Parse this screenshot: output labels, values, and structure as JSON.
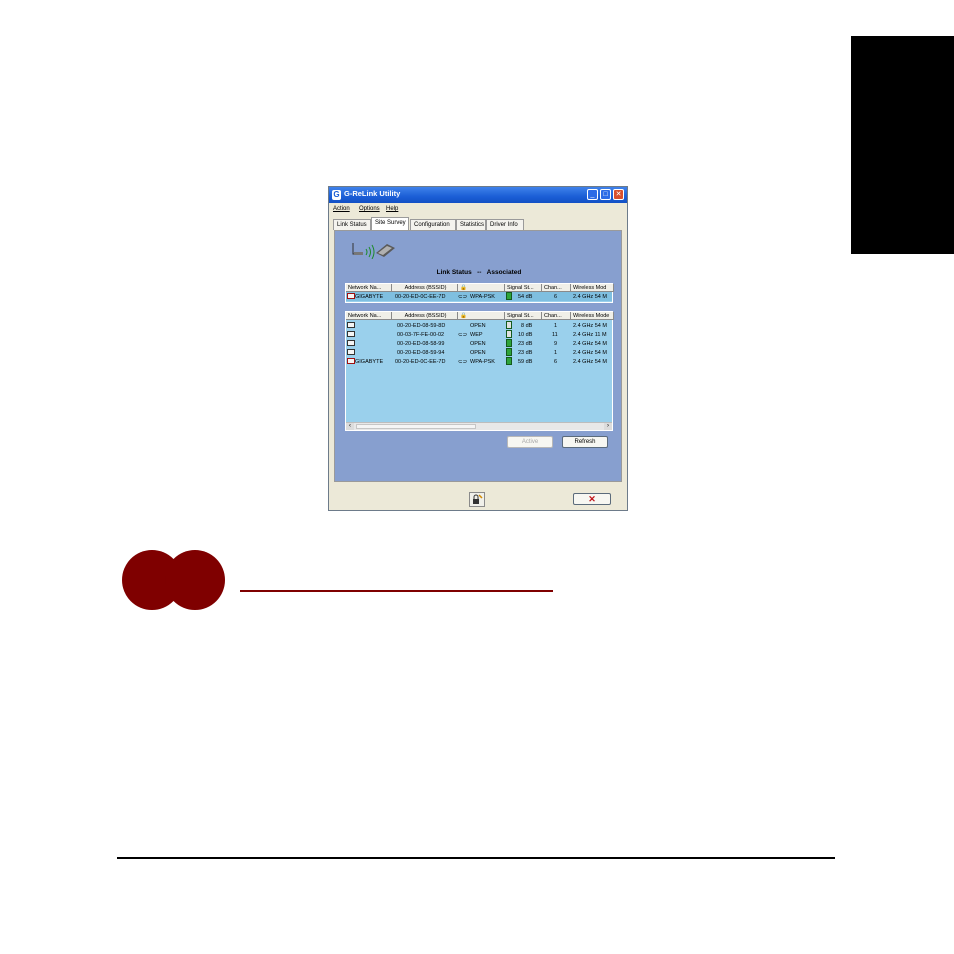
{
  "window": {
    "title": "G-ReLink Utility",
    "app_icon_glyph": "G",
    "menu": [
      "Action",
      "Options",
      "Help"
    ],
    "tabs": [
      "Link Status",
      "Site Survey",
      "Configuration",
      "Statistics",
      "Driver Info"
    ],
    "active_tab": "Site Survey"
  },
  "link_status": {
    "label": "Link Status",
    "separator": "--",
    "value": "Associated"
  },
  "columns": {
    "top": [
      "Network Na...",
      "Address (BSSID)",
      "",
      "Signal St...",
      "Chan...",
      "Wireless Mod"
    ],
    "bottom": [
      "Network Na...",
      "Address (BSSID)",
      "",
      "Signal St...",
      "Chan...",
      "Wireless Mode"
    ]
  },
  "associated": [
    {
      "name": "GIGABYTE",
      "bssid": "00-20-ED-0C-EE-7D",
      "security": "WPA-PSK",
      "signal": "54 dB",
      "channel": "6",
      "mode": "2.4 GHz 54 M"
    }
  ],
  "networks": [
    {
      "name": "",
      "bssid": "00-20-ED-08-59-8D",
      "security": "OPEN",
      "signal": "8 dB",
      "channel": "1",
      "mode": "2.4 GHz 54 M"
    },
    {
      "name": "",
      "bssid": "00-03-7F-FE-00-02",
      "security": "WEP",
      "signal": "10 dB",
      "channel": "11",
      "mode": "2.4 GHz 11 M"
    },
    {
      "name": "",
      "bssid": "00-20-ED-08-58-99",
      "security": "OPEN",
      "signal": "23 dB",
      "channel": "9",
      "mode": "2.4 GHz 54 M"
    },
    {
      "name": "",
      "bssid": "00-20-ED-08-59-94",
      "security": "OPEN",
      "signal": "23 dB",
      "channel": "1",
      "mode": "2.4 GHz 54 M"
    },
    {
      "name": "GIGABYTE",
      "bssid": "00-20-ED-0C-EE-7D",
      "security": "WPA-PSK",
      "signal": "59 dB",
      "channel": "6",
      "mode": "2.4 GHz 54 M"
    }
  ],
  "buttons": {
    "action": "Active",
    "refresh": "Refresh",
    "close_glyph": "✕"
  },
  "colors": {
    "accent_red": "#7f0000",
    "panel_blue": "#879fcf",
    "list_blue": "#9ad0ec"
  }
}
